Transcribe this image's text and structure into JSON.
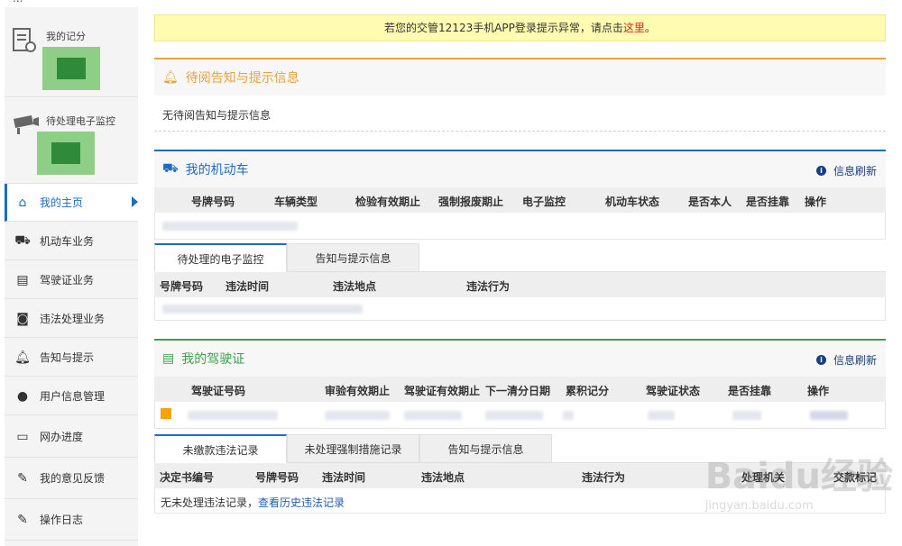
{
  "sidebar": {
    "card_points_label": "我的记分",
    "card_monitor_label": "待处理电子监控",
    "items": [
      {
        "label": "我的主页",
        "icon": "home-icon"
      },
      {
        "label": "机动车业务",
        "icon": "truck-icon"
      },
      {
        "label": "驾驶证业务",
        "icon": "license-card-icon"
      },
      {
        "label": "违法处理业务",
        "icon": "camera-icon"
      },
      {
        "label": "告知与提示",
        "icon": "bell-icon"
      },
      {
        "label": "用户信息管理",
        "icon": "user-icon"
      },
      {
        "label": "网办进度",
        "icon": "progress-icon"
      },
      {
        "label": "我的意见反馈",
        "icon": "feedback-icon"
      },
      {
        "label": "操作日志",
        "icon": "log-icon"
      }
    ]
  },
  "notice": {
    "text": "若您的交管12123手机APP登录提示异常，请点击",
    "link": "这里",
    "end": "。"
  },
  "notify_panel": {
    "title": "待阅告知与提示信息",
    "empty": "无待阅告知与提示信息"
  },
  "vehicle_panel": {
    "title": "我的机动车",
    "refresh": "信息刷新",
    "columns": [
      "号牌号码",
      "车辆类型",
      "检验有效期止",
      "强制报废期止",
      "电子监控",
      "机动车状态",
      "是否本人",
      "是否挂靠",
      "操作"
    ],
    "tabs": [
      "待处理的电子监控",
      "告知与提示信息"
    ],
    "sub_columns": [
      "号牌号码",
      "违法时间",
      "违法地点",
      "违法行为"
    ]
  },
  "license_panel": {
    "title": "我的驾驶证",
    "refresh": "信息刷新",
    "columns": [
      "驾驶证号码",
      "审验有效期止",
      "驾驶证有效期止",
      "下一清分日期",
      "累积记分",
      "驾驶证状态",
      "是否挂靠",
      "操作"
    ],
    "tabs": [
      "未缴款违法记录",
      "未处理强制措施记录",
      "告知与提示信息"
    ],
    "sub_columns": [
      "决定书编号",
      "号牌号码",
      "违法时间",
      "违法地点",
      "违法行为",
      "处理机关",
      "交款标记"
    ],
    "empty_text": "无未处理违法记录，",
    "history_link": "查看历史违法记录"
  },
  "watermark": {
    "brand": "Baidu经验",
    "url": "jingyan.baidu.com"
  },
  "colors": {
    "accent": "#1e6ac9",
    "notice_bg": "#fffbb0",
    "notice_link": "#e02020",
    "orange_line": "#e8a23a",
    "green_line": "#3aa24a",
    "blue_line": "#1e6ac9"
  }
}
